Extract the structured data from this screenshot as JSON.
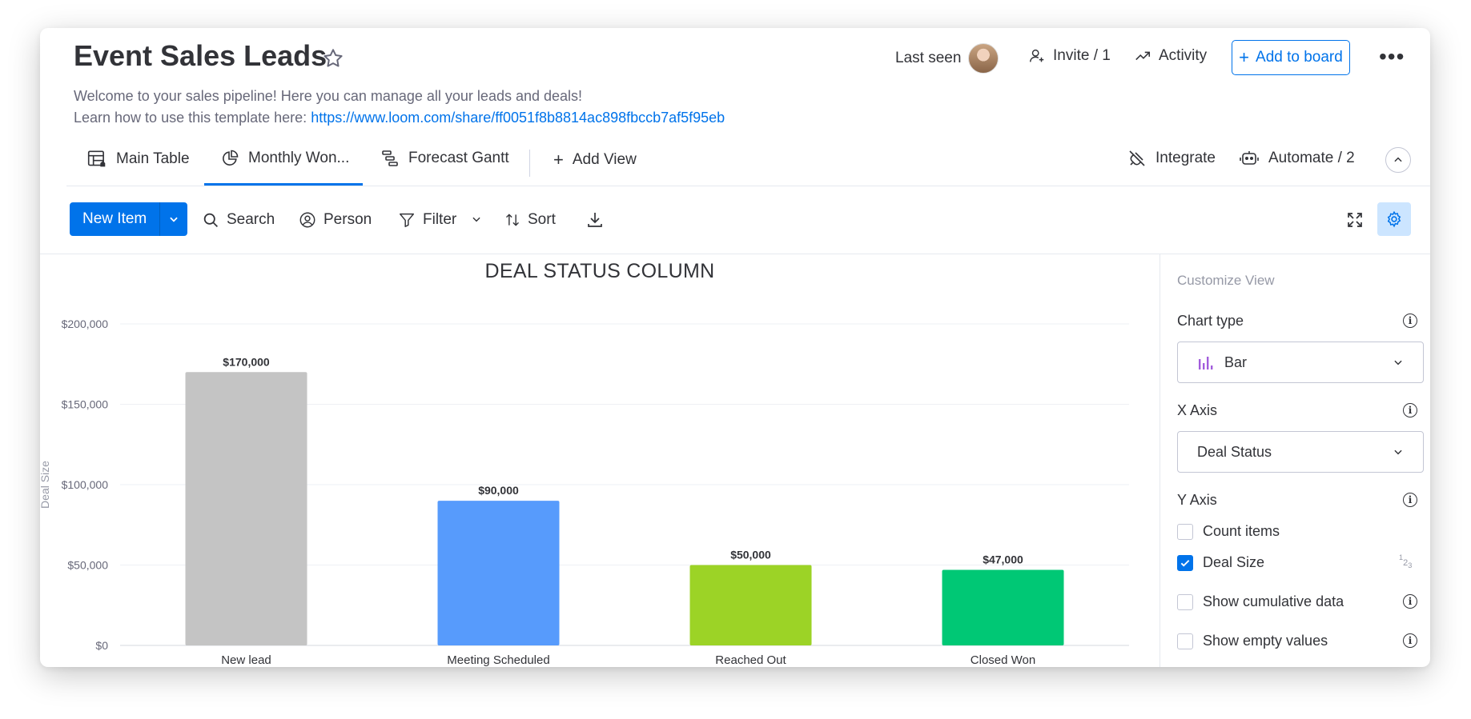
{
  "board": {
    "title": "Event Sales Leads",
    "description_line1": "Welcome to your sales pipeline! Here you can manage all your leads and deals!",
    "description_prefix": "Learn how to use this template here: ",
    "description_link": "https://www.loom.com/share/ff0051f8b8814ac898fbccb7af5f95eb"
  },
  "header": {
    "last_seen": "Last seen",
    "invite": "Invite / 1",
    "activity": "Activity",
    "add_to_board": "Add to board",
    "more_icon": "•••"
  },
  "views": {
    "tabs": [
      {
        "label": "Main Table",
        "icon": "table-icon",
        "active": false
      },
      {
        "label": "Monthly Won...",
        "icon": "pie-chart-icon",
        "active": true
      },
      {
        "label": "Forecast Gantt",
        "icon": "gantt-icon",
        "active": false
      }
    ],
    "add_view": "Add View",
    "integrate": "Integrate",
    "automate": "Automate / 2"
  },
  "toolbar": {
    "new_item": "New Item",
    "search": "Search",
    "person": "Person",
    "filter": "Filter",
    "sort": "Sort"
  },
  "chart_data": {
    "type": "bar",
    "title": "DEAL STATUS COLUMN",
    "xlabel": "",
    "ylabel": "Deal Size",
    "categories": [
      "New lead",
      "Meeting Scheduled",
      "Reached Out",
      "Closed Won"
    ],
    "values": [
      170000,
      90000,
      50000,
      47000
    ],
    "value_labels": [
      "$170,000",
      "$90,000",
      "$50,000",
      "$47,000"
    ],
    "colors": [
      "#c4c4c4",
      "#579bfc",
      "#9cd326",
      "#00c875"
    ],
    "ylim": [
      0,
      200000
    ],
    "yticks": [
      0,
      50000,
      100000,
      150000,
      200000
    ],
    "ytick_labels": [
      "$0",
      "$50,000",
      "$100,000",
      "$150,000",
      "$200,000"
    ],
    "grid": true
  },
  "panel": {
    "heading": "Customize View",
    "chart_type_label": "Chart type",
    "chart_type_value": "Bar",
    "x_axis_label": "X Axis",
    "x_axis_value": "Deal Status",
    "y_axis_label": "Y Axis",
    "options": [
      {
        "label": "Count items",
        "checked": false
      },
      {
        "label": "Deal Size",
        "checked": true
      },
      {
        "label": "Show cumulative data",
        "checked": false
      },
      {
        "label": "Show empty values",
        "checked": false
      }
    ]
  },
  "colors": {
    "accent": "#0073ea",
    "text": "#323338",
    "muted": "#676879"
  }
}
